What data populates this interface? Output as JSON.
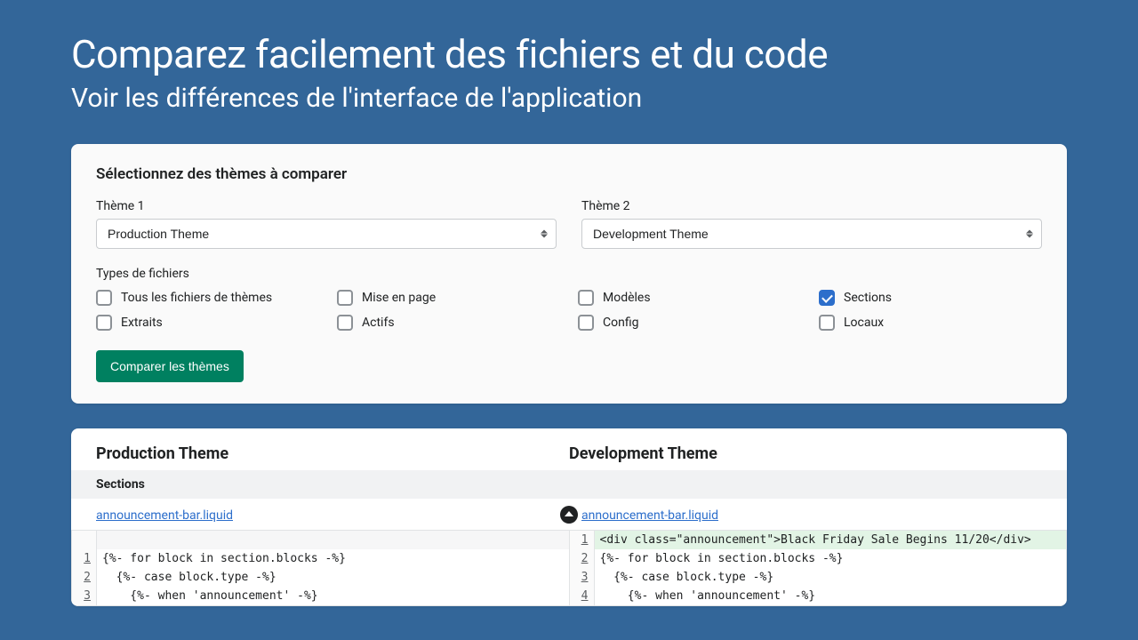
{
  "hero": {
    "title": "Comparez facilement des fichiers et du code",
    "subtitle": "Voir les différences de l'interface de l'application"
  },
  "form": {
    "heading": "Sélectionnez des thèmes à comparer",
    "theme1_label": "Thème 1",
    "theme1_value": "Production Theme",
    "theme2_label": "Thème 2",
    "theme2_value": "Development Theme",
    "filetypes_label": "Types de fichiers",
    "checkboxes": {
      "all": {
        "label": "Tous les fichiers de thèmes",
        "checked": false
      },
      "layout": {
        "label": "Mise en page",
        "checked": false
      },
      "templates": {
        "label": "Modèles",
        "checked": false
      },
      "sections": {
        "label": "Sections",
        "checked": true
      },
      "snippets": {
        "label": "Extraits",
        "checked": false
      },
      "assets": {
        "label": "Actifs",
        "checked": false
      },
      "config": {
        "label": "Config",
        "checked": false
      },
      "locales": {
        "label": "Locaux",
        "checked": false
      }
    },
    "compare_button": "Comparer les thèmes"
  },
  "results": {
    "left_heading": "Production Theme",
    "right_heading": "Development Theme",
    "section_label": "Sections",
    "file_left": "announcement-bar.liquid",
    "file_right": "announcement-bar.liquid",
    "left_code": {
      "l1": "{%- for block in section.blocks -%}",
      "l2": "  {%- case block.type -%}",
      "l3": "    {%- when 'announcement' -%}"
    },
    "right_code": {
      "l1": "<div class=\"announcement\">Black Friday Sale Begins 11/20</div>",
      "l2": "{%- for block in section.blocks -%}",
      "l3": "  {%- case block.type -%}",
      "l4": "    {%- when 'announcement' -%}"
    }
  }
}
